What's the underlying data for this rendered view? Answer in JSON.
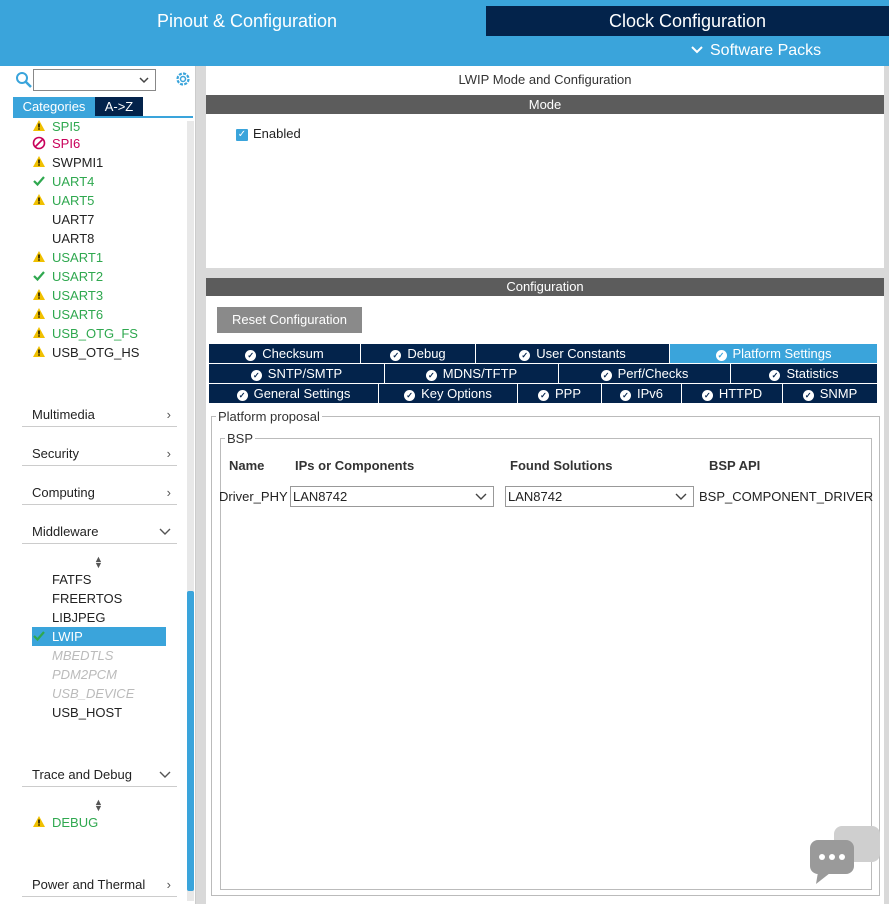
{
  "header": {
    "tab_pinout": "Pinout & Configuration",
    "tab_clock": "Clock Configuration",
    "software_packs": "Software Packs"
  },
  "sidebar": {
    "search": {
      "value": ""
    },
    "tabs": {
      "categories": "Categories",
      "az": "A->Z"
    },
    "items": [
      {
        "label": "SPI5",
        "status": "warning"
      },
      {
        "label": "SPI6",
        "status": "disabled-red"
      },
      {
        "label": "SWPMI1",
        "status": "warning"
      },
      {
        "label": "UART4",
        "status": "ok"
      },
      {
        "label": "UART5",
        "status": "warning"
      },
      {
        "label": "UART7",
        "status": "none"
      },
      {
        "label": "UART8",
        "status": "none"
      },
      {
        "label": "USART1",
        "status": "warning"
      },
      {
        "label": "USART2",
        "status": "ok"
      },
      {
        "label": "USART3",
        "status": "warning"
      },
      {
        "label": "USART6",
        "status": "warning"
      },
      {
        "label": "USB_OTG_FS",
        "status": "warning"
      },
      {
        "label": "USB_OTG_HS",
        "status": "warning"
      }
    ],
    "categories": {
      "multimedia": "Multimedia",
      "security": "Security",
      "computing": "Computing",
      "middleware": "Middleware",
      "trace_debug": "Trace and Debug",
      "power_thermal": "Power and Thermal"
    },
    "middleware_items": [
      {
        "label": "FATFS",
        "state": "normal"
      },
      {
        "label": "FREERTOS",
        "state": "normal"
      },
      {
        "label": "LIBJPEG",
        "state": "normal"
      },
      {
        "label": "LWIP",
        "state": "selected"
      },
      {
        "label": "MBEDTLS",
        "state": "disabled"
      },
      {
        "label": "PDM2PCM",
        "state": "disabled"
      },
      {
        "label": "USB_DEVICE",
        "state": "disabled"
      },
      {
        "label": "USB_HOST",
        "state": "normal"
      }
    ],
    "trace_items": [
      {
        "label": "DEBUG",
        "status": "warning"
      }
    ]
  },
  "mode": {
    "title": "LWIP Mode and Configuration",
    "header": "Mode",
    "enabled_label": "Enabled",
    "enabled": true
  },
  "config": {
    "header": "Configuration",
    "reset_button": "Reset Configuration",
    "tabs_row1": [
      "Checksum",
      "Debug",
      "User Constants",
      "Platform Settings"
    ],
    "tabs_row2": [
      "SNTP/SMTP",
      "MDNS/TFTP",
      "Perf/Checks",
      "Statistics"
    ],
    "tabs_row3": [
      "General Settings",
      "Key Options",
      "PPP",
      "IPv6",
      "HTTPD",
      "SNMP"
    ],
    "active_tab": "Platform Settings",
    "proposal_legend": "Platform proposal",
    "bsp_legend": "BSP",
    "columns": [
      "Name",
      "IPs or Components",
      "Found Solutions",
      "BSP API"
    ],
    "row": {
      "name": "Driver_PHY",
      "ip": "LAN8742",
      "solution": "LAN8742",
      "api": "BSP_COMPONENT_DRIVER"
    }
  },
  "colors": {
    "accent": "#3aa4db",
    "navy": "#03234b",
    "ok": "#2fa84f",
    "warning": "#f0c000",
    "error": "#c8005a"
  }
}
